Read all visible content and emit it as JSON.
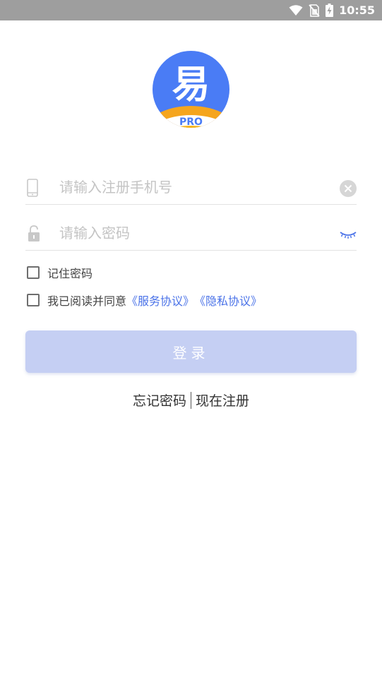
{
  "status_bar": {
    "time": "10:55",
    "icons": [
      "wifi-icon",
      "no-sim-icon",
      "battery-charging-icon"
    ]
  },
  "logo": {
    "character": "易",
    "badge": "PRO",
    "colors": {
      "circle": "#4a7cf5",
      "arc": "#f5a51e",
      "badge_bg": "#ffffff"
    }
  },
  "phone_field": {
    "placeholder": "请输入注册手机号",
    "value": "",
    "icon": "phone-icon",
    "action_icon": "clear-icon"
  },
  "password_field": {
    "placeholder": "请输入密码",
    "value": "",
    "icon": "lock-icon",
    "action_icon": "eye-closed-icon"
  },
  "remember": {
    "label": "记住密码",
    "checked": false
  },
  "agreement": {
    "label": "我已阅读并同意",
    "service_link": "《服务协议》",
    "privacy_link": "《隐私协议》",
    "checked": false
  },
  "login_button": {
    "label": "登录"
  },
  "bottom_links": {
    "forgot": "忘记密码",
    "register": "现在注册"
  },
  "colors": {
    "accent": "#4a72e8",
    "button_disabled": "#c5cff3",
    "status_bar": "#9e9e9e"
  }
}
